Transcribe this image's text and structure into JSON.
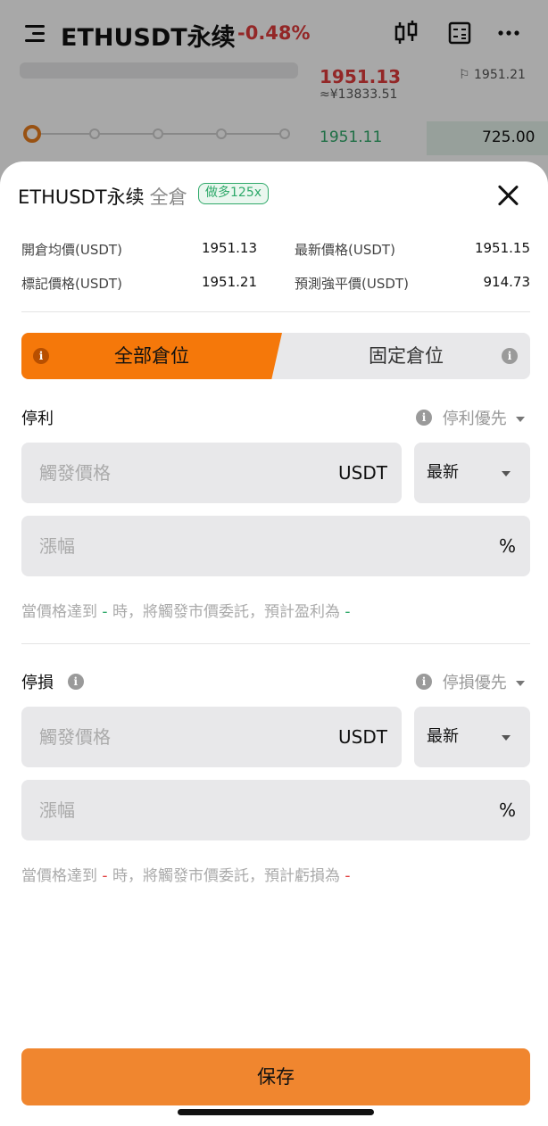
{
  "background": {
    "title": "ETHUSDT永续",
    "change": "-0.48%",
    "price_red": "1951.13",
    "approx_cny": "≈¥13833.51",
    "mark_price": "1951.21",
    "orderbook_price": "1951.11",
    "orderbook_qty": "725.00"
  },
  "sheet": {
    "symbol": "ETHUSDT永续",
    "margin_mode": "全倉",
    "badge": "做多125x",
    "info": {
      "avg_open_label": "開倉均價(USDT)",
      "avg_open_value": "1951.13",
      "last_price_label": "最新價格(USDT)",
      "last_price_value": "1951.15",
      "mark_price_label": "標記價格(USDT)",
      "mark_price_value": "1951.21",
      "liq_price_label": "預測強平價(USDT)",
      "liq_price_value": "914.73"
    },
    "tabs": {
      "full": "全部倉位",
      "fixed": "固定倉位"
    },
    "take_profit": {
      "title": "停利",
      "priority": "停利優先",
      "trigger_placeholder": "觸發價格",
      "unit": "USDT",
      "price_type": "最新",
      "change_placeholder": "漲幅",
      "percent": "%",
      "hint_prefix": "當價格達到",
      "hint_value1": "-",
      "hint_mid": "時，將觸發市價委託，預計盈利為",
      "hint_value2": "-"
    },
    "stop_loss": {
      "title": "停損",
      "priority": "停損優先",
      "trigger_placeholder": "觸發價格",
      "unit": "USDT",
      "price_type": "最新",
      "change_placeholder": "漲幅",
      "percent": "%",
      "hint_prefix": "當價格達到",
      "hint_value1": "-",
      "hint_mid": "時，將觸發市價委託，預計虧損為",
      "hint_value2": "-"
    },
    "save": "保存"
  }
}
